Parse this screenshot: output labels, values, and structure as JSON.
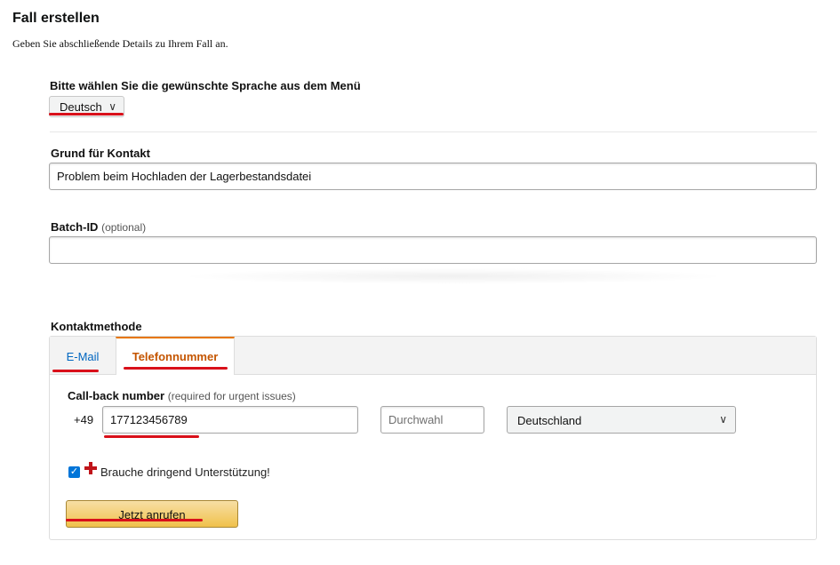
{
  "header": {
    "title": "Fall erstellen",
    "subtitle": "Geben Sie abschließende Details zu Ihrem Fall an."
  },
  "language": {
    "label": "Bitte wählen Sie die gewünschte Sprache aus dem Menü",
    "selected": "Deutsch",
    "chevron_icon": "chevron-down-icon"
  },
  "reason": {
    "label": "Grund für Kontakt",
    "value": "Problem beim Hochladen der Lagerbestandsdatei"
  },
  "batch": {
    "label": "Batch-ID",
    "optional": "(optional)",
    "value": ""
  },
  "contact": {
    "label": "Kontaktmethode",
    "tabs": [
      {
        "label": "E-Mail",
        "active": false
      },
      {
        "label": "Telefonnummer",
        "active": true
      }
    ]
  },
  "phone": {
    "label": "Call-back number",
    "hint": "(required for urgent issues)",
    "prefix": "+49",
    "number": "177123456789",
    "extension_placeholder": "Durchwahl",
    "country": "Deutschland"
  },
  "urgent": {
    "checked": true,
    "label": "Brauche dringend Unterstützung!"
  },
  "submit": {
    "label": "Jetzt anrufen"
  },
  "colors": {
    "accent_tab": "#c45500",
    "link": "#0066c0",
    "button_top": "#f7dfa5",
    "button_bottom": "#f0c14b",
    "annotation": "#d9101a"
  }
}
